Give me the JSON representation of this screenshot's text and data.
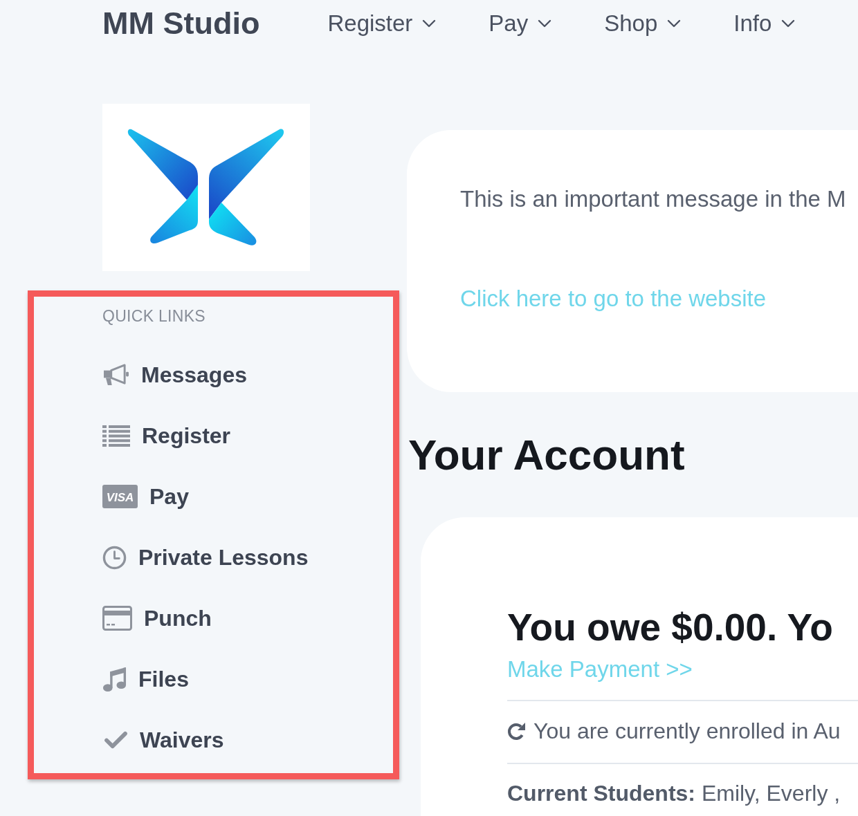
{
  "header": {
    "brand": "MM Studio",
    "nav": [
      {
        "label": "Register",
        "dropdown": true
      },
      {
        "label": "Pay",
        "dropdown": true
      },
      {
        "label": "Shop",
        "dropdown": true
      },
      {
        "label": "Info",
        "dropdown": true
      }
    ]
  },
  "sidebar": {
    "highlighted": true,
    "title": "QUICK LINKS",
    "items": [
      {
        "kind": "messages",
        "label": "Messages"
      },
      {
        "kind": "register",
        "label": "Register"
      },
      {
        "kind": "pay",
        "label": "Pay",
        "icon_text": "VISA"
      },
      {
        "kind": "lessons",
        "label": "Private Lessons"
      },
      {
        "kind": "punch",
        "label": "Punch"
      },
      {
        "kind": "files",
        "label": "Files"
      },
      {
        "kind": "waivers",
        "label": "Waivers"
      }
    ]
  },
  "message_card": {
    "text": "This is an important message in the M",
    "link": "Click here to go to the website"
  },
  "account": {
    "heading": "Your Account",
    "balance": "You owe $0.00. Yo",
    "payment_link": "Make Payment >>",
    "enrollment": "You are currently enrolled in Au",
    "students": "**Current Students:** Emily, Everly ,"
  }
}
